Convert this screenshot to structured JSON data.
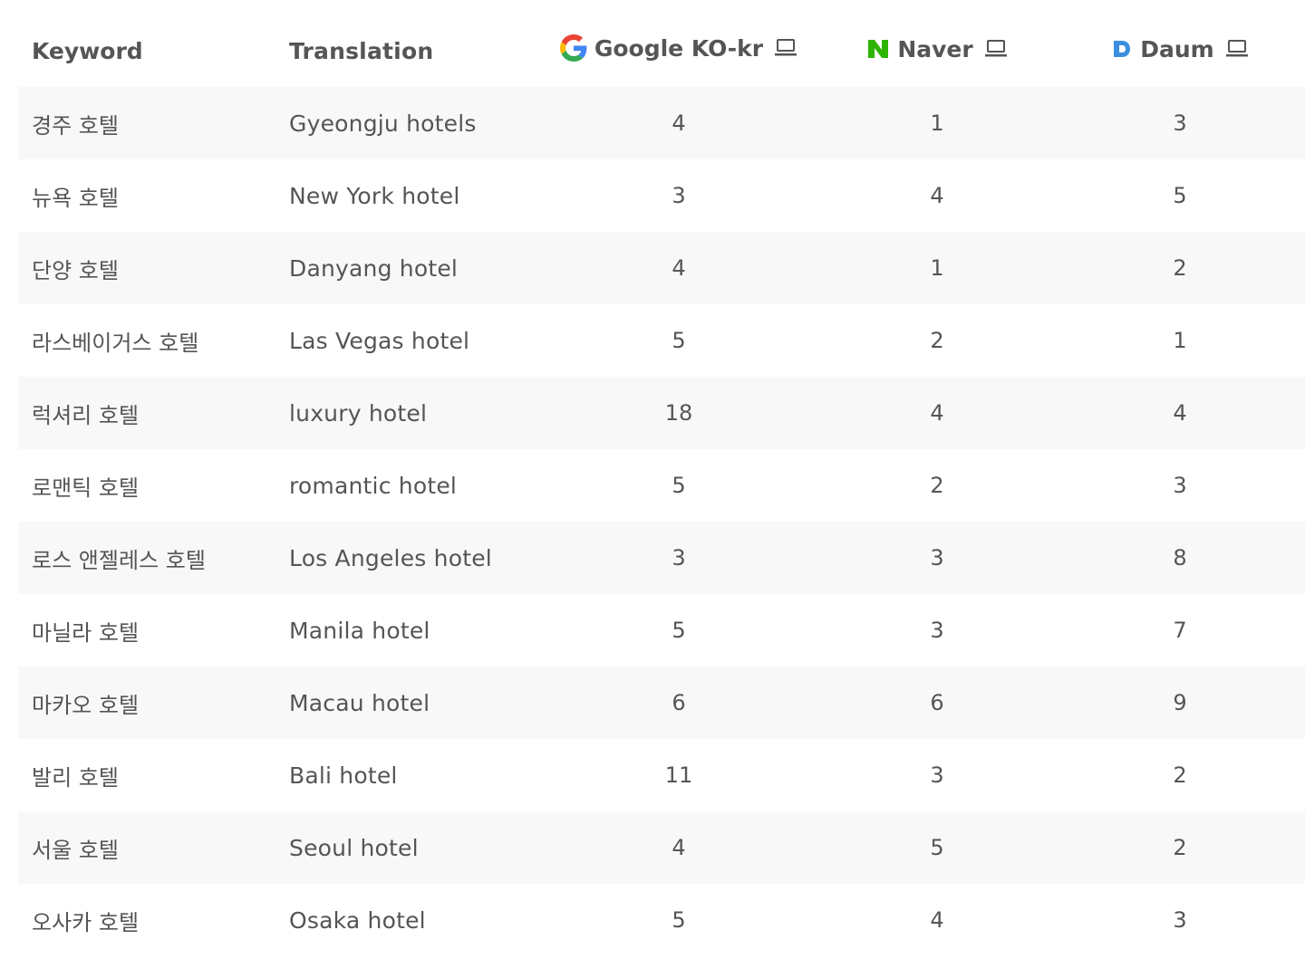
{
  "columns": {
    "keyword": "Keyword",
    "translation": "Translation",
    "google": "Google KO-kr",
    "naver": "Naver",
    "daum": "Daum"
  },
  "icons": {
    "google": "google-logo-icon",
    "naver": "naver-logo-icon",
    "daum": "daum-logo-icon",
    "device": "laptop-icon"
  },
  "colors": {
    "naver_green": "#2db400",
    "daum_blue": "#3b8fe0",
    "stripe": "#f8f8f8",
    "text": "#555555"
  },
  "rows": [
    {
      "keyword": "경주 호텔",
      "translation": "Gyeongju hotels",
      "google": "4",
      "naver": "1",
      "daum": "3"
    },
    {
      "keyword": "뉴욕 호텔",
      "translation": "New York hotel",
      "google": "3",
      "naver": "4",
      "daum": "5"
    },
    {
      "keyword": "단양 호텔",
      "translation": "Danyang hotel",
      "google": "4",
      "naver": "1",
      "daum": "2"
    },
    {
      "keyword": "라스베이거스 호텔",
      "translation": "Las Vegas hotel",
      "google": "5",
      "naver": "2",
      "daum": "1"
    },
    {
      "keyword": "럭셔리 호텔",
      "translation": "luxury hotel",
      "google": "18",
      "naver": "4",
      "daum": "4"
    },
    {
      "keyword": "로맨틱 호텔",
      "translation": "romantic hotel",
      "google": "5",
      "naver": "2",
      "daum": "3"
    },
    {
      "keyword": "로스 앤젤레스 호텔",
      "translation": "Los Angeles hotel",
      "google": "3",
      "naver": "3",
      "daum": "8"
    },
    {
      "keyword": "마닐라 호텔",
      "translation": "Manila hotel",
      "google": "5",
      "naver": "3",
      "daum": "7"
    },
    {
      "keyword": "마카오 호텔",
      "translation": "Macau hotel",
      "google": "6",
      "naver": "6",
      "daum": "9"
    },
    {
      "keyword": "발리 호텔",
      "translation": "Bali hotel",
      "google": "11",
      "naver": "3",
      "daum": "2"
    },
    {
      "keyword": "서울 호텔",
      "translation": "Seoul hotel",
      "google": "4",
      "naver": "5",
      "daum": "2"
    },
    {
      "keyword": "오사카 호텔",
      "translation": "Osaka hotel",
      "google": "5",
      "naver": "4",
      "daum": "3"
    }
  ]
}
